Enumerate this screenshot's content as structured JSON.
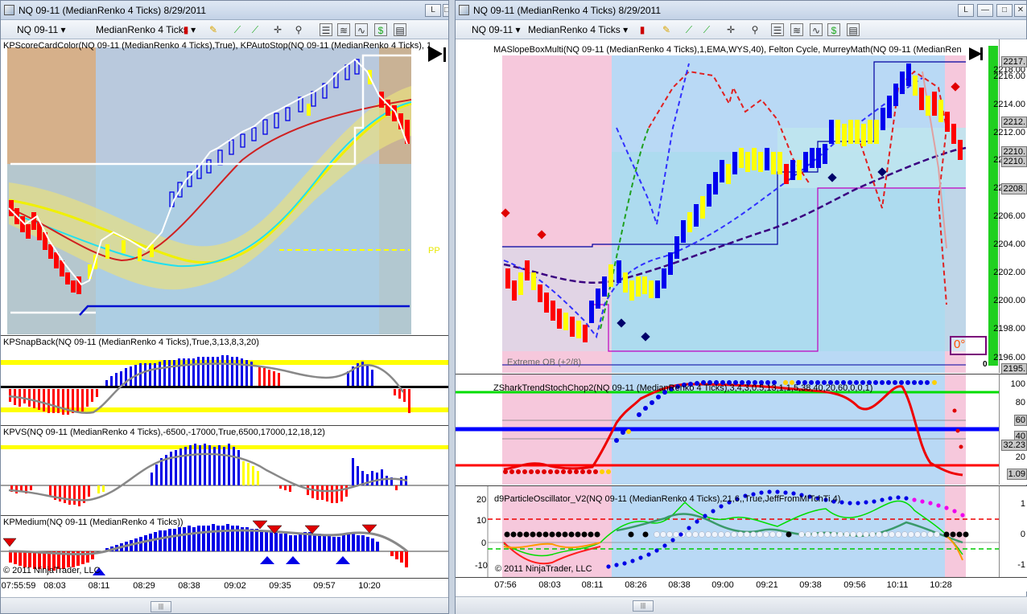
{
  "left_window": {
    "title": "NQ 09-11 (MedianRenko 4 Ticks)  8/29/2011",
    "title_buttons": [
      "L",
      "□"
    ],
    "toolbar": {
      "instrument": "NQ 09-11",
      "period": "MedianRenko 4 Ticks"
    },
    "panes": {
      "price": {
        "label": "KPScoreCardColor(NQ 09-11 (MedianRenko 4 Ticks),True), KPAutoStop(NQ 09-11 (MedianRenko 4 Ticks), 1",
        "pp_text": "PP"
      },
      "snapback": {
        "label": "KPSnapBack(NQ 09-11 (MedianRenko 4 Ticks),True,3,13,8,3,20)"
      },
      "kpvs": {
        "label": "KPVS(NQ 09-11 (MedianRenko 4 Ticks),-6500,-17000,True,6500,17000,12,18,12)"
      },
      "medium": {
        "label": "KPMedium(NQ 09-11 (MedianRenko 4 Ticks))"
      }
    },
    "copyright": "© 2011 NinjaTrader, LLC",
    "x_labels": [
      "07:55:59",
      "08:03",
      "08:11",
      "08:29",
      "08:38",
      "09:02",
      "09:35",
      "09:57",
      "10:20"
    ],
    "scroll_thumb": "|||"
  },
  "right_window": {
    "title": "NQ 09-11 (MedianRenko 4 Ticks)  8/29/2011",
    "title_buttons": [
      "L",
      "—",
      "□",
      "✕"
    ],
    "toolbar": {
      "instrument": "NQ 09-11",
      "period": "MedianRenko 4 Ticks"
    },
    "panes": {
      "price": {
        "label": "MASlopeBoxMulti(NQ 09-11 (MedianRenko 4 Ticks),1,EMA,WYS,40), Felton Cycle, MurreyMath(NQ 09-11 (MedianRen",
        "ob_label": "Extreme OB (+2/8)",
        "zero_box": "0°",
        "gbar_value": "0",
        "y_labels": [
          "2218.00",
          "2216.00",
          "2214.00",
          "2212.00",
          "2210.00",
          "2208.00",
          "2206.00",
          "2204.00",
          "2202.00",
          "2200.00",
          "2198.00",
          "2196.00"
        ],
        "y_tags": [
          "2217.",
          "2212.",
          "2210.",
          "2210.",
          "2208.",
          "2195."
        ]
      },
      "shark": {
        "label": "ZSharkTrendStochChop2(NQ 09-11 (MedianRenko 4 Ticks),3,4,3,0.5,13,1,1,5,38,40,20,60,0,0,1)",
        "y_labels": [
          "100",
          "80",
          "60",
          "40",
          "20",
          "0"
        ],
        "y_tags": [
          "60",
          "40",
          "32.23",
          "1.09"
        ]
      },
      "particle": {
        "label": "d9ParticleOscillator_V2(NQ 09-11 (MedianRenko 4 Ticks),21,6,,True,JeffFromMITchTi,4)",
        "y_left": [
          "20",
          "10",
          "0",
          "-10"
        ],
        "y_right": [
          "1",
          "0",
          "-1"
        ]
      }
    },
    "copyright": "© 2011 NinjaTrader, LLC",
    "x_labels": [
      "07:56",
      "08:03",
      "08:11",
      "08:26",
      "08:38",
      "09:00",
      "09:21",
      "09:38",
      "09:56",
      "10:11",
      "10:28"
    ],
    "scroll_thumb": "|||"
  },
  "colors": {
    "up_bar": "#0000e6",
    "down_bar": "#ff0000",
    "neutral_bar": "#ffff00",
    "pink_zone": "#f6c8dc",
    "blue_zone": "#b8d8f4",
    "brown_zone": "#d8b08c",
    "green": "#00d000"
  }
}
